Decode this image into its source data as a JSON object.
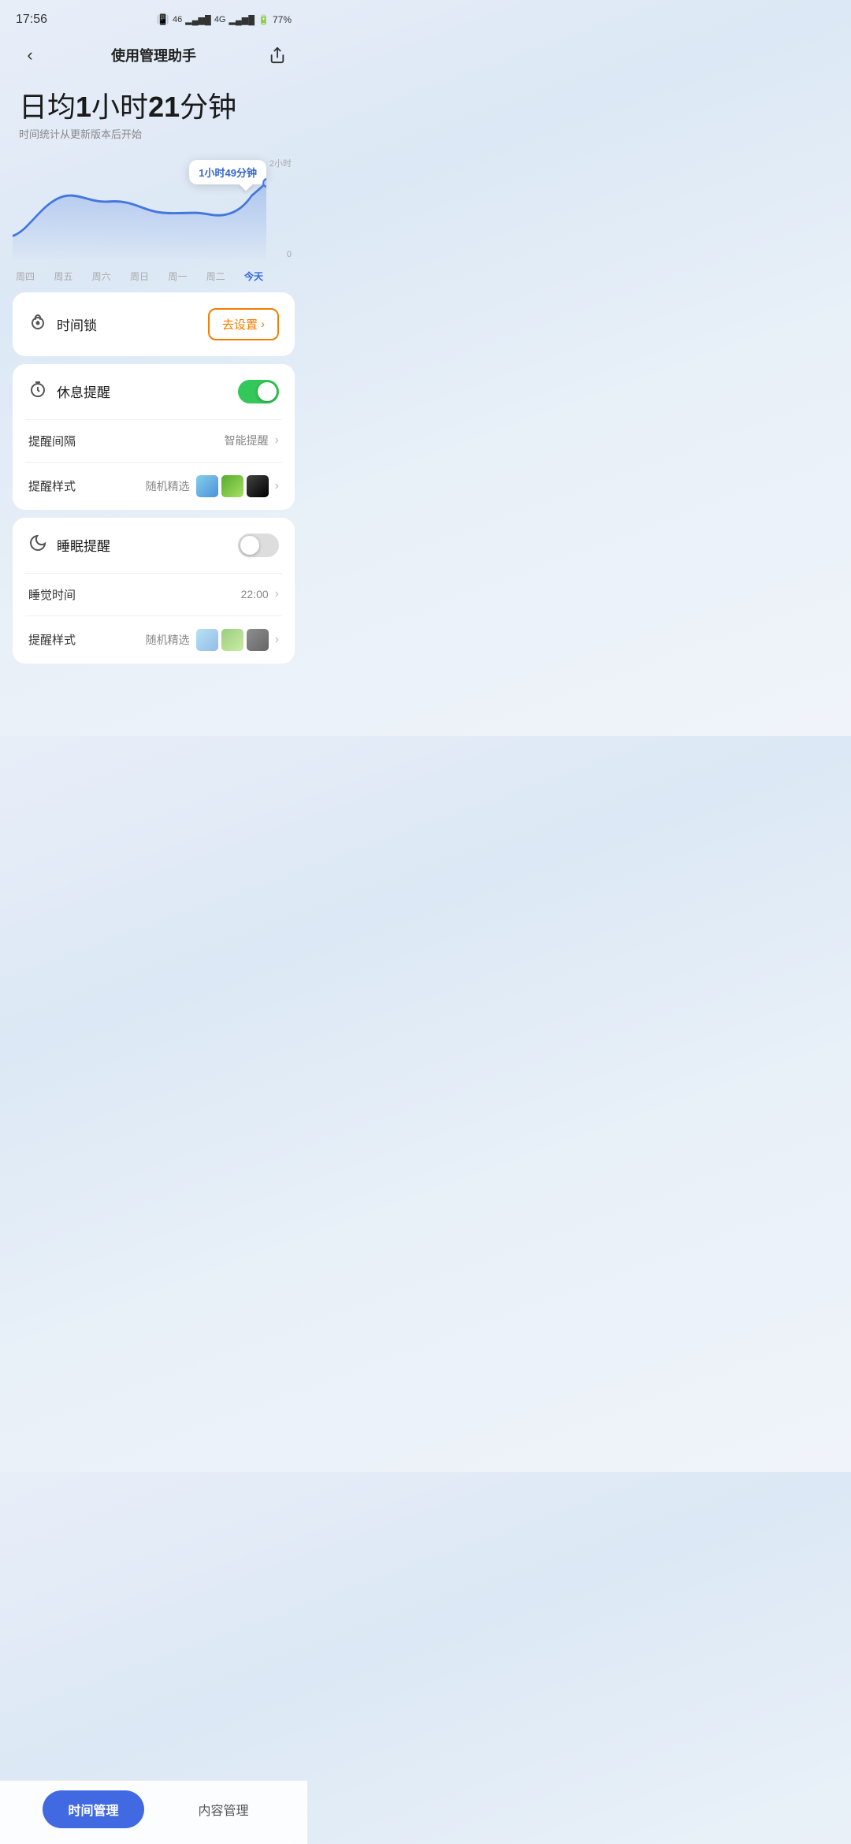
{
  "statusBar": {
    "time": "17:56",
    "battery": "77%",
    "signal": "46 4G"
  },
  "header": {
    "title": "使用管理助手",
    "backLabel": "‹",
    "shareLabel": "↗"
  },
  "stats": {
    "avgPrefix": "日均",
    "avgBold1": "1",
    "avgUnit1": "小时",
    "avgBold2": "21",
    "avgUnit2": "分钟",
    "subtitle": "时间统计从更新版本后开始"
  },
  "chart": {
    "tooltip": "1小时49分钟",
    "yLabels": [
      "2小时",
      "0"
    ],
    "xLabels": [
      "周四",
      "周五",
      "周六",
      "周日",
      "周一",
      "周二",
      "今天"
    ]
  },
  "timeLock": {
    "icon": "⏰",
    "label": "时间锁",
    "btnLabel": "去设置",
    "btnChevron": "›"
  },
  "restReminder": {
    "icon": "⏱",
    "label": "休息提醒",
    "toggleOn": true,
    "intervalLabel": "提醒间隔",
    "intervalValue": "智能提醒",
    "styleLabel": "提醒样式",
    "styleValue": "随机精选"
  },
  "sleepReminder": {
    "icon": "🌙",
    "label": "睡眠提醒",
    "toggleOn": false,
    "sleepTimeLabel": "睡觉时间",
    "sleepTimeValue": "22:00",
    "styleLabel": "提醒样式",
    "styleValue": "随机精选"
  },
  "bottomNav": {
    "activeLabel": "时间管理",
    "inactiveLabel": "内容管理"
  }
}
